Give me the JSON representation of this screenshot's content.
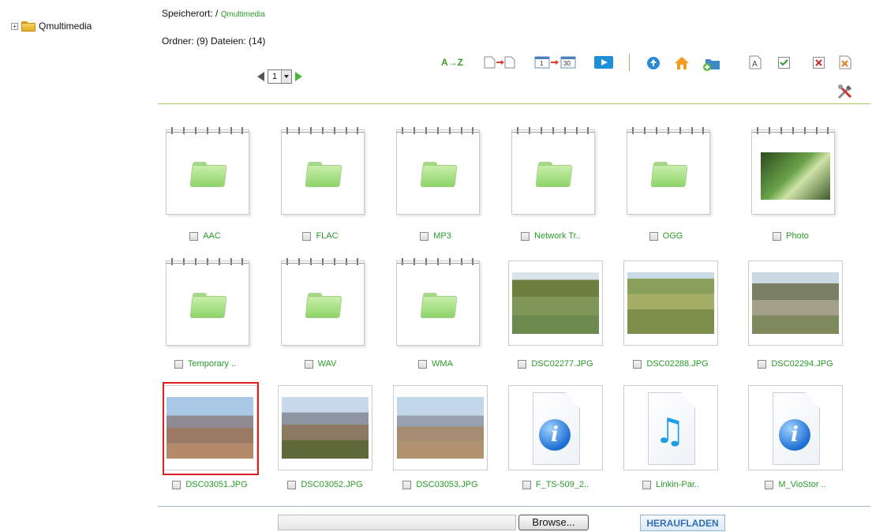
{
  "tree": {
    "expander": "+",
    "root_label": "Qmultimedia"
  },
  "location": {
    "prefix": "Speicherort: / ",
    "path": "Qmultimedia"
  },
  "counts": "Ordner: (9) Dateien: (14)",
  "pager": {
    "page": "1"
  },
  "toolbar": {
    "sort_az": "A→Z",
    "date_from": "1",
    "date_to": "30",
    "icons": [
      "sort-az-icon",
      "move-file-icon",
      "date-range-icon",
      "slideshow-icon",
      "up-folder-icon",
      "home-icon",
      "new-folder-icon",
      "rename-icon",
      "select-all-icon",
      "deselect-icon",
      "delete-icon",
      "tools-icon"
    ]
  },
  "items": [
    {
      "name": "AAC",
      "type": "folder"
    },
    {
      "name": "FLAC",
      "type": "folder"
    },
    {
      "name": "MP3",
      "type": "folder"
    },
    {
      "name": "Network Tr..",
      "type": "folder"
    },
    {
      "name": "OGG",
      "type": "folder"
    },
    {
      "name": "Photo",
      "type": "folder-photo"
    },
    {
      "name": "Temporary ..",
      "type": "folder"
    },
    {
      "name": "WAV",
      "type": "folder"
    },
    {
      "name": "WMA",
      "type": "folder"
    },
    {
      "name": "DSC02277.JPG",
      "type": "photo"
    },
    {
      "name": "DSC02288.JPG",
      "type": "photo"
    },
    {
      "name": "DSC02294.JPG",
      "type": "photo"
    },
    {
      "name": "DSC03051.JPG",
      "type": "photo",
      "selected": true
    },
    {
      "name": "DSC03052.JPG",
      "type": "photo"
    },
    {
      "name": "DSC03053.JPG",
      "type": "photo"
    },
    {
      "name": "F_TS-509_2..",
      "type": "doc-info"
    },
    {
      "name": "Linkin-Par..",
      "type": "doc-music"
    },
    {
      "name": "M_VioStor ..",
      "type": "doc-info"
    }
  ],
  "upload": {
    "browse_label": "Browse...",
    "upload_label": "HERAUFLADEN"
  }
}
